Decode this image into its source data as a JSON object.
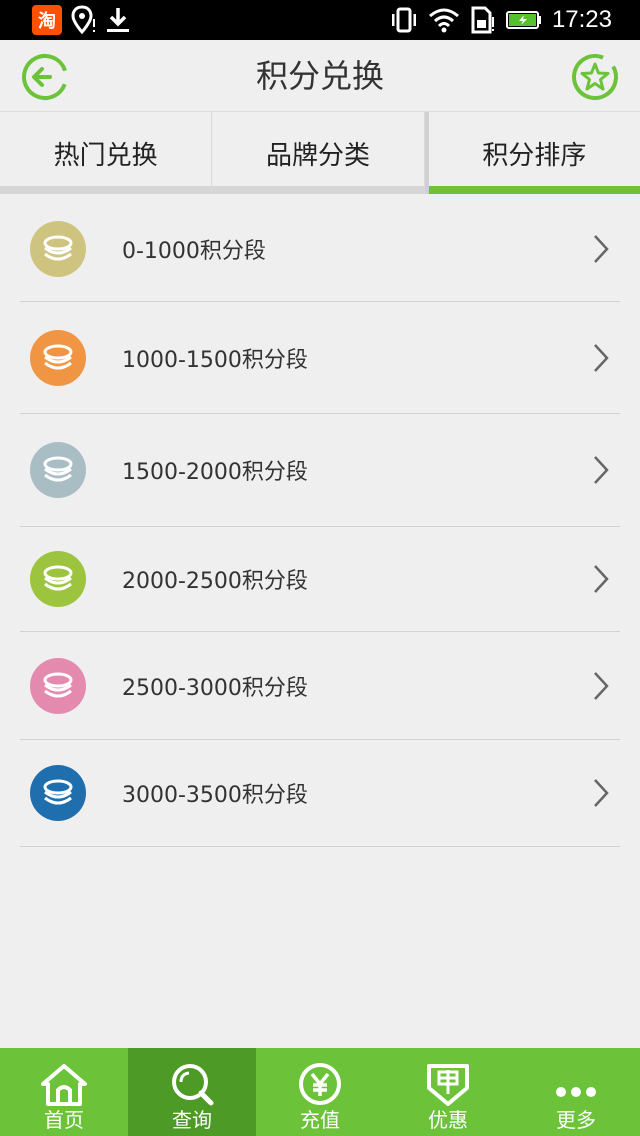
{
  "status_bar": {
    "taobao_glyph": "淘",
    "time": "17:23",
    "icons": [
      "taobao-icon",
      "location-icon",
      "download-icon",
      "vibrate-icon",
      "wifi-icon",
      "sim-icon",
      "battery-charging-icon"
    ]
  },
  "header": {
    "title": "积分兑换",
    "back_icon": "back-arrow-icon",
    "favorite_icon": "star-icon"
  },
  "tabs": [
    {
      "label": "热门兑换",
      "active": false
    },
    {
      "label": "品牌分类",
      "active": false
    },
    {
      "label": "积分排序",
      "active": true
    }
  ],
  "ranges": [
    {
      "label": "0-1000积分段",
      "color": "#cfc47f"
    },
    {
      "label": "1000-1500积分段",
      "color": "#f09543"
    },
    {
      "label": "1500-2000积分段",
      "color": "#a9bdc4"
    },
    {
      "label": "2000-2500积分段",
      "color": "#9cc43e"
    },
    {
      "label": "2500-3000积分段",
      "color": "#e58aaf"
    },
    {
      "label": "3000-3500积分段",
      "color": "#1f6fae"
    }
  ],
  "bottom_nav": [
    {
      "label": "首页",
      "icon": "home-icon",
      "active": false
    },
    {
      "label": "查询",
      "icon": "search-icon",
      "active": true
    },
    {
      "label": "充值",
      "icon": "yen-icon",
      "active": false
    },
    {
      "label": "优惠",
      "icon": "coupon-icon",
      "active": false
    },
    {
      "label": "更多",
      "icon": "more-icon",
      "active": false
    }
  ],
  "colors": {
    "accent": "#6cc33a",
    "accent_dark": "#4d9a27",
    "background": "#efefef"
  }
}
